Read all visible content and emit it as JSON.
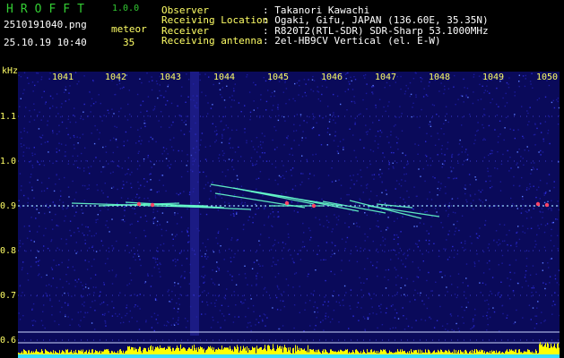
{
  "header": {
    "logo": "HROFFT",
    "version": "1.0.0",
    "filename": "2510191040.png",
    "datetime": "25.10.19 10:40",
    "meteor_label": "meteor",
    "meteor_count": "35",
    "info": [
      {
        "label": "Observer",
        "value": ": Takanori Kawachi"
      },
      {
        "label": "Receiving Location",
        "value": ": Ogaki, Gifu, JAPAN (136.60E, 35.35N)"
      },
      {
        "label": "Receiver",
        "value": ": R820T2(RTL-SDR) SDR-Sharp 53.1000MHz"
      },
      {
        "label": "Receiving antenna",
        "value": ": 2el-HB9CV Vertical (el. E-W)"
      }
    ]
  },
  "axes": {
    "y_unit": "kHz",
    "x_ticks": [
      "1041",
      "1042",
      "1043",
      "1044",
      "1045",
      "1046",
      "1047",
      "1048",
      "1049",
      "1050"
    ],
    "y_ticks": [
      "1.1",
      "1.0",
      "0.9",
      "0.8",
      "0.7",
      "0.6"
    ],
    "minor_y": [
      "1.1",
      "1.0",
      "0.9",
      "0.8",
      "0.7",
      "0.6"
    ]
  },
  "colors": {
    "background": "#000000",
    "spectrogram_bg": "#0a0a5a",
    "axis_text": "#ffff66",
    "logo": "#33cc33",
    "signal": "#66ffcc",
    "level_bar": "#ffff00",
    "level_base": "#33ddff"
  }
}
